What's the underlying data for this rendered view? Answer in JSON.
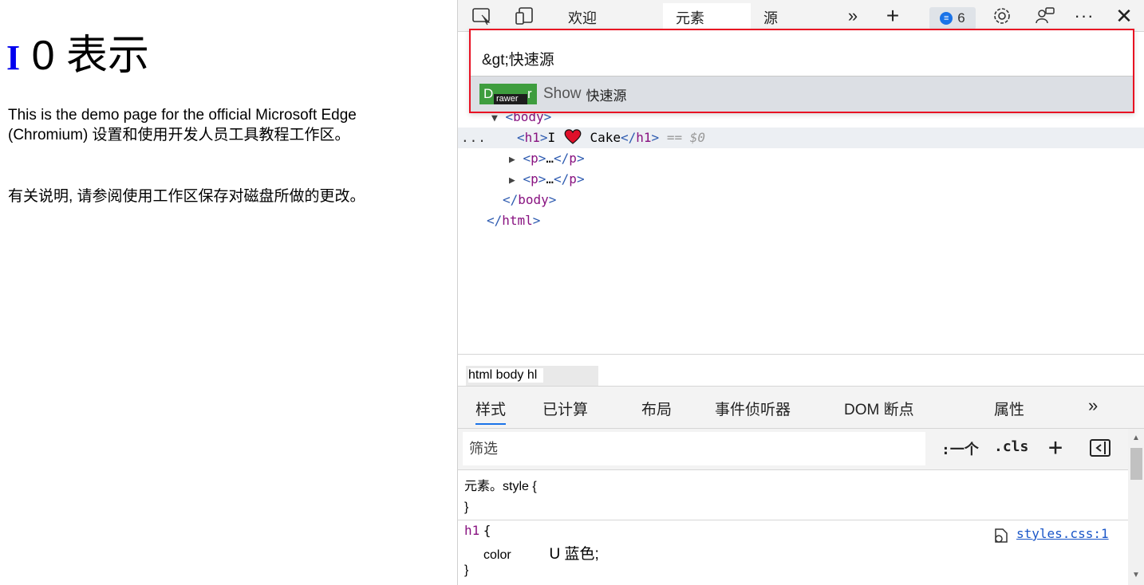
{
  "page": {
    "heading_i": "I",
    "heading_rest": "0 表示",
    "para1": "This is the demo page for the official Microsoft Edge (Chromium) 设置和使用开发人员工具教程工作区。",
    "para2": "有关说明, 请参阅使用工作区保存对磁盘所做的更改。"
  },
  "toolbar": {
    "tabs": [
      "欢迎",
      "元素",
      "源"
    ],
    "active_tab": "元素",
    "issues_count": "6",
    "icons": [
      "inspect-icon",
      "device-emulation-icon",
      "more-tabs-icon",
      "add-tab-icon",
      "issues-icon",
      "settings-icon",
      "feedback-icon",
      "more-options-icon",
      "close-icon"
    ]
  },
  "command_menu": {
    "input_value": "&gt;快速源",
    "result_category": "D",
    "result_category_sub": "rawer",
    "result_category_tail": "r",
    "result_prefix": "Show",
    "result_name": "快速源"
  },
  "tree": {
    "body_open": "body",
    "h1_tag": "h1",
    "h1_text_before": "I",
    "h1_text_after": "Cake",
    "eq_marker": "== $0",
    "p_tag": "p",
    "ellipsis": "…",
    "body_close": "body",
    "html_close": "html",
    "dots": "..."
  },
  "breadcrumbs": {
    "path": "html body hl"
  },
  "subtabs": [
    "样式",
    "已计算",
    "布局",
    "事件侦听器",
    "DOM 断点",
    "属性"
  ],
  "filter": {
    "placeholder": "筛选",
    "hov_label": ":一个",
    "cls_label": ".cls"
  },
  "styles": {
    "element_style_label": "元素。style {",
    "close_brace": "}",
    "h1_selector": "h1",
    "open_brace": "{",
    "property": "color",
    "value": "U 蓝色;",
    "source_link": "styles.css:1"
  },
  "colors": {
    "accent": "#1a73e8",
    "highlight_border": "#e81123",
    "chip_green": "#3e9d3e",
    "tag_purple": "#881280",
    "heart_red": "#e0102a"
  }
}
